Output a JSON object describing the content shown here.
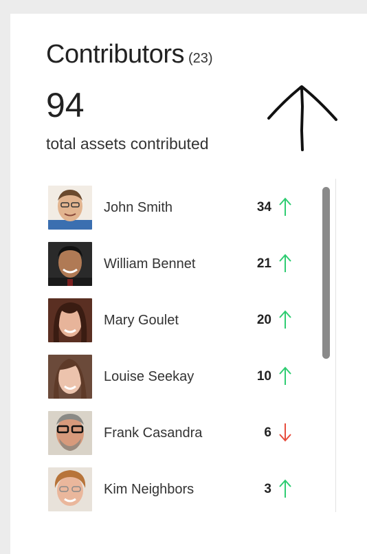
{
  "header": {
    "title": "Contributors",
    "count": "(23)",
    "total": "94",
    "total_label": "total assets contributed"
  },
  "colors": {
    "up": "#2ecc71",
    "down": "#e74c3c",
    "scrollbar": "#8a8a8a"
  },
  "contributors": [
    {
      "name": "John Smith",
      "count": "34",
      "trend": "up",
      "trend_icon": "arrow-up-icon"
    },
    {
      "name": "William Bennet",
      "count": "21",
      "trend": "up",
      "trend_icon": "arrow-up-icon"
    },
    {
      "name": "Mary Goulet",
      "count": "20",
      "trend": "up",
      "trend_icon": "arrow-up-icon"
    },
    {
      "name": "Louise Seekay",
      "count": "10",
      "trend": "up",
      "trend_icon": "arrow-up-icon"
    },
    {
      "name": "Frank Casandra",
      "count": "6",
      "trend": "down",
      "trend_icon": "arrow-down-icon"
    },
    {
      "name": "Kim Neighbors",
      "count": "3",
      "trend": "up",
      "trend_icon": "arrow-up-icon"
    }
  ]
}
